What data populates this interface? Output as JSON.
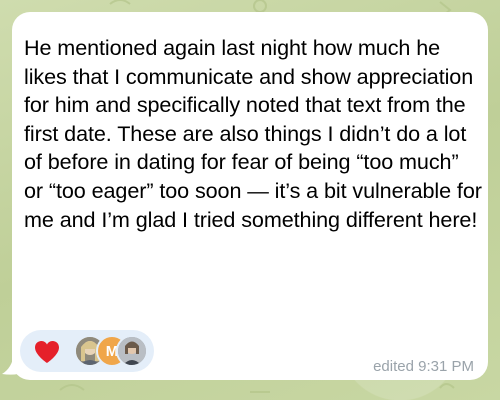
{
  "message": {
    "text": "He mentioned again last night how much he likes that I communicate and show appreciation for him and specifically noted that text from the first date. These are also things I didn’t do a lot of before in dating for fear of being “too much” or “too eager” too soon — it’s a bit vulnerable for me and I’m glad I tried something different here!",
    "timestamp": "edited 9:31 PM"
  },
  "reactions": {
    "emoji": "heart",
    "reactors": [
      {
        "icon": "photo-avatar-icon"
      },
      {
        "initial": "M",
        "color": "#f0a64a"
      },
      {
        "icon": "photo-avatar-icon"
      }
    ]
  },
  "colors": {
    "bubble": "#ffffff",
    "reaction_pill": "#e4eef9",
    "heart": "#e5202a",
    "timestamp": "#9aa3aa",
    "chat_background": "#c9d6a8"
  }
}
